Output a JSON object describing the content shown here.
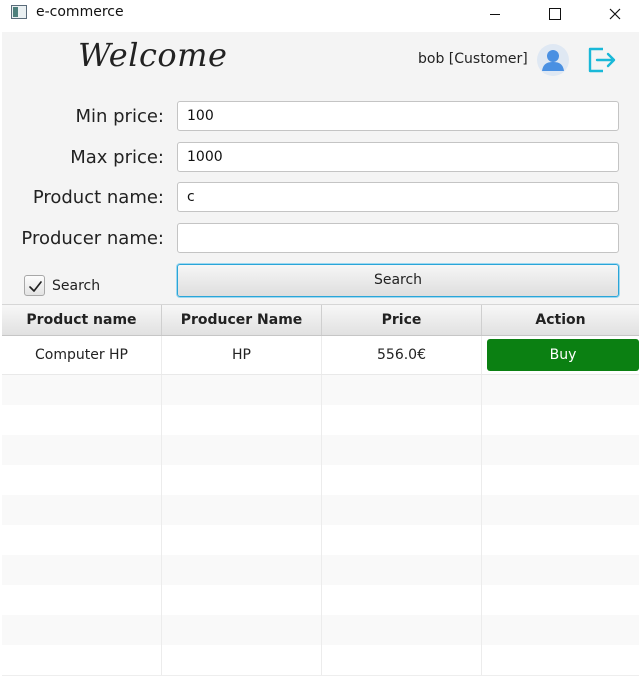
{
  "window": {
    "title": "e-commerce"
  },
  "header": {
    "welcome": "Welcome",
    "user": "bob [Customer]"
  },
  "filters": {
    "min_price_label": "Min price:",
    "min_price_value": "100",
    "max_price_label": "Max price:",
    "max_price_value": "1000",
    "product_name_label": "Product name:",
    "product_name_value": "c",
    "producer_name_label": "Producer name:",
    "producer_name_value": "",
    "search_checkbox_label": "Search",
    "search_checkbox_checked": true,
    "search_button_label": "Search"
  },
  "table": {
    "columns": [
      "Product name",
      "Producer Name",
      "Price",
      "Action"
    ],
    "rows": [
      {
        "product": "Computer HP",
        "producer": "HP",
        "price": "556.0€",
        "action": "Buy"
      }
    ]
  },
  "colors": {
    "buy": "#0b8012",
    "avatar": "#4a90e2",
    "logout": "#19b8d8"
  }
}
